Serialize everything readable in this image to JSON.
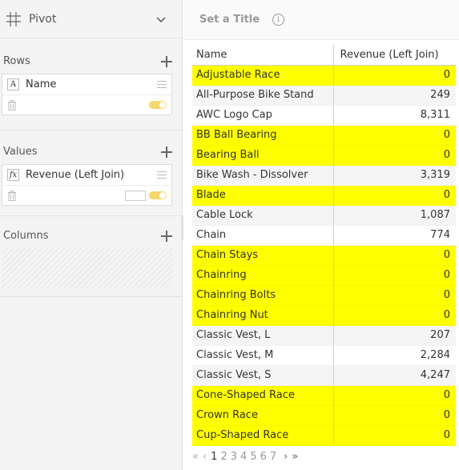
{
  "pivot": {
    "title": "Pivot"
  },
  "rows_section": {
    "label": "Rows",
    "field": {
      "type": "A",
      "name": "Name"
    }
  },
  "values_section": {
    "label": "Values",
    "field": {
      "type": "fx",
      "name": "Revenue (Left Join)"
    }
  },
  "columns_section": {
    "label": "Columns"
  },
  "chart_title": {
    "placeholder": "Set a Title"
  },
  "table": {
    "headers": [
      "Name",
      "Revenue (Left Join)"
    ],
    "rows": [
      {
        "name": "Adjustable Race",
        "value": "0",
        "highlight": true
      },
      {
        "name": "All-Purpose Bike Stand",
        "value": "249",
        "highlight": false
      },
      {
        "name": "AWC Logo Cap",
        "value": "8,311",
        "highlight": false
      },
      {
        "name": "BB Ball Bearing",
        "value": "0",
        "highlight": true
      },
      {
        "name": "Bearing Ball",
        "value": "0",
        "highlight": true
      },
      {
        "name": "Bike Wash - Dissolver",
        "value": "3,319",
        "highlight": false
      },
      {
        "name": "Blade",
        "value": "0",
        "highlight": true
      },
      {
        "name": "Cable Lock",
        "value": "1,087",
        "highlight": false
      },
      {
        "name": "Chain",
        "value": "774",
        "highlight": false
      },
      {
        "name": "Chain Stays",
        "value": "0",
        "highlight": true
      },
      {
        "name": "Chainring",
        "value": "0",
        "highlight": true
      },
      {
        "name": "Chainring Bolts",
        "value": "0",
        "highlight": true
      },
      {
        "name": "Chainring Nut",
        "value": "0",
        "highlight": true
      },
      {
        "name": "Classic Vest, L",
        "value": "207",
        "highlight": false
      },
      {
        "name": "Classic Vest, M",
        "value": "2,284",
        "highlight": false
      },
      {
        "name": "Classic Vest, S",
        "value": "4,247",
        "highlight": false
      },
      {
        "name": "Cone-Shaped Race",
        "value": "0",
        "highlight": true
      },
      {
        "name": "Crown Race",
        "value": "0",
        "highlight": true
      },
      {
        "name": "Cup-Shaped Race",
        "value": "0",
        "highlight": true
      }
    ]
  },
  "pager": {
    "first": "«",
    "prev": "‹",
    "pages": [
      "1",
      "2",
      "3",
      "4",
      "5",
      "6",
      "7"
    ],
    "current": "1",
    "next": "›",
    "last": "»"
  },
  "colors": {
    "highlight": "#ffff00",
    "toggle": "#f5d76e"
  }
}
